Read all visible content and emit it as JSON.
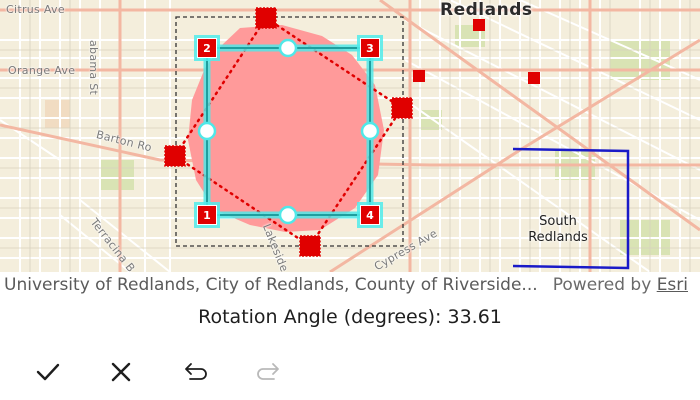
{
  "map": {
    "labels": {
      "citrus_ave": "Citrus Ave",
      "orange_ave": "Orange Ave",
      "alabama_st": "abama St",
      "barton_rd": "Barton Ro",
      "terracina": "Terracina B",
      "lakeside": "Lakeside A",
      "cypress_ave": "Cypress Ave",
      "redlands": "Redlands",
      "south_redlands": "South\nRedlands"
    },
    "vertices": [
      "1",
      "2",
      "3",
      "4"
    ],
    "colors": {
      "polygon_fill": "#ff9a9a",
      "edge": "#e00000",
      "highlight": "#50e8e8",
      "bounding_box": "#333333",
      "boundary_line": "#1a1ac8",
      "road_major": "#f3b7a2",
      "road_minor": "#ffffff",
      "park": "#d9e3b4"
    }
  },
  "attribution": {
    "text": "University of Redlands, City of Redlands, County of Riverside...",
    "powered_by": "Powered by",
    "provider": "Esri"
  },
  "rotation": {
    "label": "Rotation Angle (degrees): 33.61"
  },
  "toolbar": {
    "accept": "check-icon",
    "cancel": "close-icon",
    "undo": "undo-icon",
    "redo": "redo-icon",
    "redo_enabled": false
  }
}
